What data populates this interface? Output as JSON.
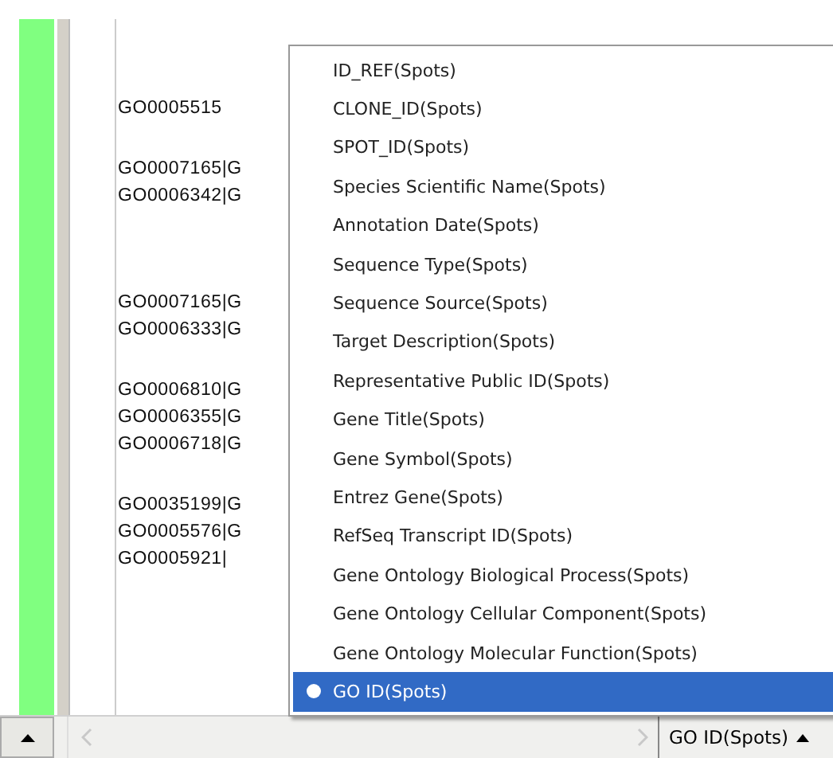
{
  "table": {
    "groups": [
      {
        "lines": [
          "GO0005515"
        ]
      },
      {
        "lines": [
          "GO0007165|G",
          "GO0006342|G"
        ]
      },
      {
        "lines": [
          "GO0007165|G",
          "GO0006333|G"
        ]
      },
      {
        "lines": [
          "GO0006810|G",
          "GO0006355|G",
          "GO0006718|G"
        ]
      },
      {
        "lines": [
          "GO0035199|G",
          "GO0005576|G",
          "GO0005921|"
        ]
      }
    ]
  },
  "menu": {
    "items": [
      {
        "label": "ID_REF(Spots)",
        "selected": false
      },
      {
        "label": "CLONE_ID(Spots)",
        "selected": false
      },
      {
        "label": "SPOT_ID(Spots)",
        "selected": false
      },
      {
        "label": "Species Scientific Name(Spots)",
        "selected": false
      },
      {
        "label": "Annotation Date(Spots)",
        "selected": false
      },
      {
        "label": "Sequence Type(Spots)",
        "selected": false
      },
      {
        "label": "Sequence Source(Spots)",
        "selected": false
      },
      {
        "label": "Target Description(Spots)",
        "selected": false
      },
      {
        "label": "Representative Public ID(Spots)",
        "selected": false
      },
      {
        "label": "Gene Title(Spots)",
        "selected": false
      },
      {
        "label": "Gene Symbol(Spots)",
        "selected": false
      },
      {
        "label": "Entrez Gene(Spots)",
        "selected": false
      },
      {
        "label": "RefSeq Transcript ID(Spots)",
        "selected": false
      },
      {
        "label": "Gene Ontology Biological Process(Spots)",
        "selected": false
      },
      {
        "label": "Gene Ontology Cellular Component(Spots)",
        "selected": false
      },
      {
        "label": "Gene Ontology Molecular Function(Spots)",
        "selected": false
      },
      {
        "label": "GO ID(Spots)",
        "selected": true
      }
    ]
  },
  "column_selector": {
    "value": "GO ID(Spots)"
  }
}
